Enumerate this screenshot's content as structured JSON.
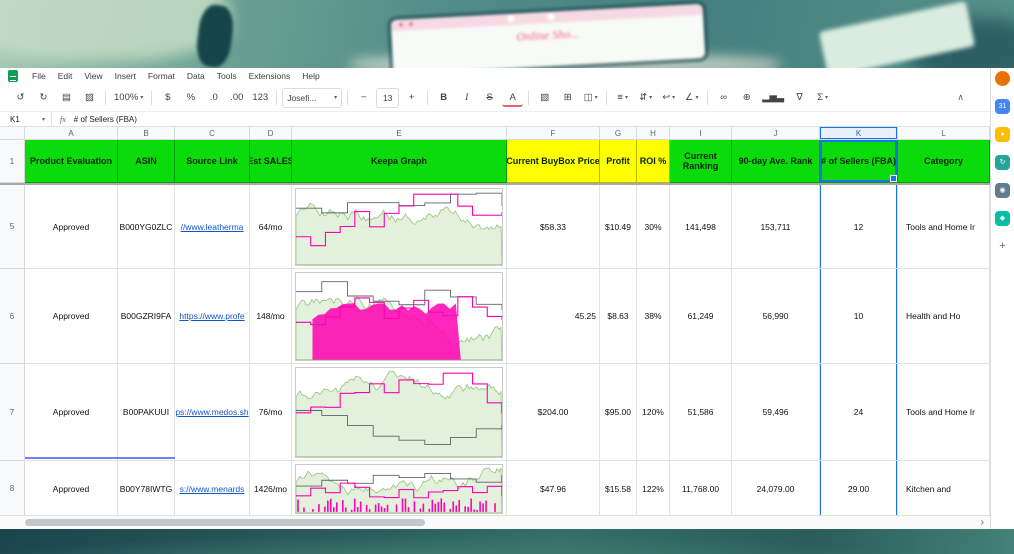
{
  "background": {
    "laptop_text": "Online Sho..."
  },
  "icons": {
    "caret_down": "▾"
  },
  "menubar": {
    "menus": [
      "File",
      "Edit",
      "View",
      "Insert",
      "Format",
      "Data",
      "Tools",
      "Extensions",
      "Help"
    ]
  },
  "toolbar": {
    "items": [
      {
        "name": "undo",
        "label": "↺"
      },
      {
        "name": "redo",
        "label": "↻"
      },
      {
        "name": "print",
        "label": "▤"
      },
      {
        "name": "paint-format",
        "label": "▨"
      },
      {
        "name": "separator"
      },
      {
        "name": "zoom-select",
        "label": "100%",
        "caret": true
      },
      {
        "name": "separator"
      },
      {
        "name": "format-as-currency",
        "label": "$"
      },
      {
        "name": "format-as-percent",
        "label": "%"
      },
      {
        "name": "decrease-decimal-places",
        "label": ".0"
      },
      {
        "name": "increase-decimal-places",
        "label": ".00"
      },
      {
        "name": "more-formats",
        "label": "123"
      },
      {
        "name": "separator"
      },
      {
        "name": "font-select",
        "label": "Josefi...",
        "caret": true,
        "cls": "tb-box tb-font"
      },
      {
        "name": "separator"
      },
      {
        "name": "decrease-font-size",
        "label": "−"
      },
      {
        "name": "font-size-input",
        "label": "13",
        "cls": "tb-box"
      },
      {
        "name": "increase-font-size",
        "label": "+"
      },
      {
        "name": "separator"
      },
      {
        "name": "bold",
        "label": "B",
        "cls": "tb-b"
      },
      {
        "name": "italic",
        "label": "I",
        "cls": "tb-i"
      },
      {
        "name": "strikethrough",
        "label": "S",
        "cls": "tb-s"
      },
      {
        "name": "text-color",
        "label": "A",
        "cls": "tb-a"
      },
      {
        "name": "separator"
      },
      {
        "name": "fill-color",
        "label": "▧"
      },
      {
        "name": "borders",
        "label": "⊞"
      },
      {
        "name": "merge-cells",
        "label": "◫",
        "caret": true
      },
      {
        "name": "separator"
      },
      {
        "name": "horizontal-align",
        "label": "≡",
        "caret": true
      },
      {
        "name": "vertical-align",
        "label": "⇵",
        "caret": true
      },
      {
        "name": "text-wrapping",
        "label": "↩",
        "caret": true
      },
      {
        "name": "text-rotation",
        "label": "∠",
        "caret": true
      },
      {
        "name": "separator"
      },
      {
        "name": "insert-link",
        "label": "∞"
      },
      {
        "name": "insert-comment",
        "label": "⊕"
      },
      {
        "name": "insert-chart",
        "label": "▂▅▃"
      },
      {
        "name": "create-filter",
        "label": "∇"
      },
      {
        "name": "functions",
        "label": "Σ",
        "caret": true
      }
    ],
    "collapse_label": "∧"
  },
  "formula_bar": {
    "cell_ref": "K1",
    "fx_label": "fx",
    "value": "# of Sellers (FBA)"
  },
  "grid": {
    "column_letters": [
      "A",
      "B",
      "C",
      "D",
      "E",
      "F",
      "G",
      "H",
      "I",
      "J",
      "K",
      "L"
    ],
    "selected_column": "K",
    "header_row_num": "1",
    "header_cells": [
      {
        "label": "Product Evaluation",
        "bg": "green"
      },
      {
        "label": "ASIN",
        "bg": "green"
      },
      {
        "label": "Source Link",
        "bg": "green"
      },
      {
        "label": "Est SALES",
        "bg": "green"
      },
      {
        "label": "Keepa Graph",
        "bg": "green"
      },
      {
        "label": "Current BuyBox Price",
        "bg": "yellow"
      },
      {
        "label": "Profit",
        "bg": "yellow"
      },
      {
        "label": "ROI %",
        "bg": "yellow"
      },
      {
        "label": "Current Ranking",
        "bg": "green"
      },
      {
        "label": "90-day Ave. Rank",
        "bg": "green"
      },
      {
        "label": "# of Sellers (FBA)",
        "bg": "green"
      },
      {
        "label": "Category",
        "bg": "green"
      }
    ],
    "rows": [
      {
        "num": "5",
        "evaluation": "Approved",
        "asin": "B000YG0ZLC",
        "source_link": "//www.leatherma",
        "est_sales": "64/mo",
        "buybox_price": "$58.33",
        "profit": "$10.49",
        "roi": "30%",
        "current_ranking": "141,498",
        "avg_rank": "153,711",
        "sellers": "12",
        "category": "Tools and Home Ir"
      },
      {
        "num": "6",
        "evaluation": "Approved",
        "asin": "B00GZRI9FA",
        "source_link": "https://www.profe",
        "est_sales": "148/mo",
        "buybox_price": "45.25",
        "profit": "$8.63",
        "roi": "38%",
        "current_ranking": "61,249",
        "avg_rank": "56,990",
        "sellers": "10",
        "category": "Health and Ho"
      },
      {
        "num": "7",
        "evaluation": "Approved",
        "asin": "B00PAKUUI",
        "source_link": "ps://www.medos.sh",
        "est_sales": "76/mo",
        "buybox_price": "$204.00",
        "profit": "$95.00",
        "roi": "120%",
        "current_ranking": "51,586",
        "avg_rank": "59,496",
        "sellers": "24",
        "category": "Tools and Home Ir"
      },
      {
        "num": "8",
        "evaluation": "Approved",
        "asin": "B00Y78IWTG",
        "source_link": "s://www.menards",
        "est_sales": "1426/mo",
        "buybox_price": "$47.96",
        "profit": "$15.58",
        "roi": "122%",
        "current_ranking": "11,768.00",
        "avg_rank": "24,079.00",
        "sellers": "29.00",
        "category": "Kitchen and"
      }
    ]
  },
  "scrollbar": {
    "chevron": "›"
  },
  "side_panel": {
    "avatar_color": "#e8710a",
    "icons": [
      {
        "name": "calendar-icon",
        "glyph": "31",
        "color": "#4285f4",
        "fg": "#ffffff"
      },
      {
        "name": "keep-icon",
        "glyph": "●",
        "color": "#fbbc04",
        "fg": "#ffffff"
      },
      {
        "name": "tasks-icon",
        "glyph": "↻",
        "color": "#26a69a",
        "fg": "#ffffff"
      },
      {
        "name": "contacts-icon",
        "glyph": "◉",
        "color": "#607d8b",
        "fg": "#ffffff"
      },
      {
        "name": "maps-icon",
        "glyph": "◆",
        "color": "#00bfa5",
        "fg": "#ffffff"
      },
      {
        "name": "add-addon",
        "glyph": "+",
        "color": "#ffffff",
        "fg": "#5f6368"
      }
    ]
  },
  "colors": {
    "header_green": "#0bdb0b",
    "header_yellow": "#ffff00",
    "selection_blue": "#1a73e8",
    "link_blue": "#1155cc",
    "keepa_green": "#93c47d",
    "keepa_magenta": "#ff00b3"
  }
}
